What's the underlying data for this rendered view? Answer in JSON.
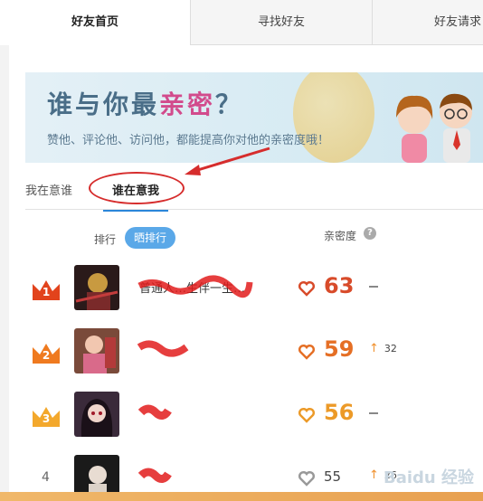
{
  "tabs": {
    "home": "好友首页",
    "find": "寻找好友",
    "requests": "好友请求"
  },
  "banner": {
    "title_pre": "谁与你最",
    "title_hl": "亲密",
    "title_post": "？",
    "subtitle": "赞他、评论他、访问他，都能提高你对他的亲密度哦！"
  },
  "subtabs": {
    "mine": "我在意谁",
    "who": "谁在意我"
  },
  "list_header": {
    "rank_label": "排行",
    "share_button": "晒排行",
    "intimacy_label": "亲密度",
    "help": "?"
  },
  "rows": [
    {
      "rank": "1",
      "name": "普通人…生伴一生…",
      "score": "63",
      "change": "",
      "score_color": "#d84b2a",
      "crown_color": "#e2431c"
    },
    {
      "rank": "2",
      "name": "",
      "score": "59",
      "change": "32",
      "score_color": "#e56f25",
      "crown_color": "#ef7a1f"
    },
    {
      "rank": "3",
      "name": "",
      "score": "56",
      "change": "",
      "score_color": "#ec9a28",
      "crown_color": "#f3a82c"
    },
    {
      "rank": "4",
      "name": "",
      "score": "55",
      "change": "26",
      "score_color": "#444444",
      "crown_color": ""
    }
  ],
  "watermark": "Baidu 经验"
}
